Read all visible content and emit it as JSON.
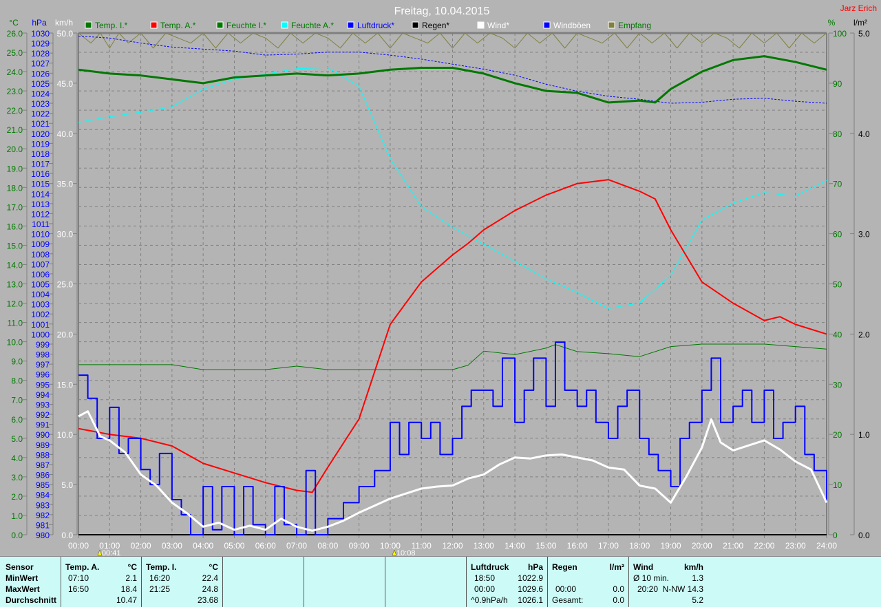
{
  "title": "Freitag, 10.04.2015",
  "author": "Jarz Erich",
  "legend": [
    {
      "label": "Temp. I.*",
      "color": "#007800",
      "text_color": "#007800"
    },
    {
      "label": "Temp. A.*",
      "color": "#ff0000",
      "text_color": "#007800"
    },
    {
      "label": "Feuchte I.*",
      "color": "#007800",
      "text_color": "#007800"
    },
    {
      "label": "Feuchte A.*",
      "color": "#00ffff",
      "text_color": "#007800"
    },
    {
      "label": "Luftdruck*",
      "color": "#0000ff",
      "text_color": "#0000ff"
    },
    {
      "label": "Regen*",
      "color": "#000000",
      "text_color": "#000000"
    },
    {
      "label": "Wind*",
      "color": "#ffffff",
      "text_color": "#ffffff"
    },
    {
      "label": "Windböen",
      "color": "#0000ff",
      "text_color": "#ffffff"
    },
    {
      "label": "Empfang",
      "color": "#808040",
      "text_color": "#007800"
    }
  ],
  "chart_data": {
    "type": "line",
    "title": "Freitag, 10.04.2015",
    "x_unit": "hour",
    "xlim": [
      0,
      24
    ],
    "x_ticks": [
      "00:00",
      "01:00",
      "02:00",
      "03:00",
      "04:00",
      "05:00",
      "06:00",
      "07:00",
      "08:00",
      "09:00",
      "10:00",
      "11:00",
      "12:00",
      "13:00",
      "14:00",
      "15:00",
      "16:00",
      "17:00",
      "18:00",
      "19:00",
      "20:00",
      "21:00",
      "22:00",
      "23:00",
      "24:00"
    ],
    "axes": {
      "temp": {
        "label": "°C",
        "range": [
          0,
          26
        ],
        "step": 1,
        "color": "#007800"
      },
      "pressure": {
        "label": "hPa",
        "range": [
          980,
          1030
        ],
        "step": 1,
        "color": "#0000ff"
      },
      "wind": {
        "label": "km/h",
        "range": [
          0,
          50
        ],
        "step": 5,
        "color": "#ffffff"
      },
      "humidity": {
        "label": "%",
        "range": [
          0,
          100
        ],
        "step": 10,
        "color": "#007800"
      },
      "rain": {
        "label": "l/m²",
        "range": [
          0,
          5
        ],
        "step": 1,
        "color": "#000000"
      }
    },
    "grid": true,
    "markers": [
      {
        "time": "00:41",
        "x": 0.683
      },
      {
        "time": "10:08",
        "x": 10.133
      }
    ],
    "series": [
      {
        "name": "Empfang",
        "axis": "humidity",
        "color": "#808040",
        "width": 1,
        "x": [
          0,
          0.4,
          0.7,
          1,
          1.3,
          1.6,
          2,
          2.4,
          2.8,
          3.2,
          3.6,
          4,
          4.4,
          4.8,
          5.2,
          5.6,
          6,
          6.4,
          6.8,
          7.2,
          7.6,
          8,
          8.4,
          8.8,
          9.2,
          9.6,
          10,
          10.4,
          10.8,
          11.2,
          11.6,
          12,
          12.4,
          12.8,
          13.2,
          13.6,
          14,
          14.4,
          14.8,
          15.2,
          15.6,
          16,
          16.4,
          16.8,
          17.2,
          17.6,
          18,
          18.4,
          18.8,
          19.2,
          19.6,
          20,
          20.4,
          20.8,
          21.2,
          21.6,
          22,
          22.4,
          22.8,
          23.2,
          23.6,
          24
        ],
        "y": [
          100,
          98,
          100,
          97,
          100,
          98,
          100,
          97,
          100,
          99,
          98,
          100,
          97,
          100,
          98,
          100,
          99,
          97,
          100,
          98,
          100,
          99,
          97,
          100,
          98,
          100,
          97,
          100,
          99,
          98,
          100,
          97,
          100,
          98,
          100,
          99,
          97,
          100,
          98,
          100,
          97,
          100,
          99,
          98,
          100,
          97,
          100,
          98,
          100,
          97,
          100,
          98,
          100,
          99,
          97,
          100,
          98,
          100,
          97,
          100,
          98,
          100
        ]
      },
      {
        "name": "Luftdruck",
        "axis": "pressure",
        "color": "#0000ff",
        "width": 1,
        "dash": true,
        "x": [
          0,
          1,
          2,
          3,
          4,
          5,
          6,
          7,
          8,
          9,
          10,
          11,
          12,
          13,
          14,
          15,
          16,
          17,
          18,
          19,
          20,
          21,
          22,
          23,
          24
        ],
        "y": [
          1029.7,
          1029.5,
          1029.0,
          1028.6,
          1028.4,
          1028.2,
          1027.8,
          1027.9,
          1028.1,
          1028.1,
          1027.8,
          1027.4,
          1026.9,
          1026.4,
          1025.8,
          1024.9,
          1024.2,
          1023.7,
          1023.4,
          1023.0,
          1023.1,
          1023.4,
          1023.5,
          1023.2,
          1023.0
        ]
      },
      {
        "name": "Feuchte I.",
        "axis": "humidity",
        "color": "#007800",
        "width": 1,
        "x": [
          0,
          1,
          2,
          3,
          4,
          5,
          6,
          7,
          8,
          9,
          10,
          11,
          12,
          12.5,
          13,
          14,
          15,
          15.3,
          16,
          17,
          18,
          19,
          20,
          21,
          22,
          23,
          24
        ],
        "y": [
          33.9,
          33.9,
          33.9,
          33.9,
          32.9,
          32.9,
          32.9,
          33.6,
          32.9,
          32.9,
          32.9,
          32.9,
          32.9,
          33.8,
          36.6,
          35.9,
          37.2,
          37.9,
          36.5,
          36.1,
          35.5,
          37.5,
          38.0,
          38.0,
          38.0,
          37.5,
          37.0
        ]
      },
      {
        "name": "Feuchte A.",
        "axis": "humidity",
        "color": "#00ffff",
        "width": 1,
        "x": [
          0,
          1,
          2,
          3,
          4,
          5,
          6,
          7,
          8,
          9,
          10,
          11,
          12,
          13,
          14,
          15,
          16,
          17,
          18,
          19,
          20,
          21,
          22,
          23,
          24
        ],
        "y": [
          82.2,
          83.3,
          84.2,
          85.3,
          88.8,
          90.8,
          91.8,
          92.9,
          93.1,
          89.4,
          75.0,
          65.4,
          61.3,
          57.9,
          54.5,
          51.0,
          48.3,
          45.1,
          46.2,
          51.7,
          62.7,
          66.1,
          68.2,
          67.5,
          70.6
        ]
      },
      {
        "name": "Temp. I.",
        "axis": "temp",
        "color": "#007800",
        "width": 3,
        "x": [
          0,
          1,
          2,
          3,
          4,
          5,
          6,
          7,
          8,
          9,
          10,
          11,
          12,
          13,
          14,
          15,
          16,
          17,
          18,
          18.5,
          19,
          20,
          21,
          22,
          23,
          24
        ],
        "y": [
          24.1,
          23.9,
          23.8,
          23.6,
          23.4,
          23.7,
          23.8,
          23.9,
          23.8,
          23.9,
          24.1,
          24.2,
          24.2,
          23.9,
          23.4,
          23.0,
          22.9,
          22.4,
          22.5,
          22.4,
          23.1,
          24.0,
          24.6,
          24.8,
          24.5,
          24.1
        ]
      },
      {
        "name": "Temp. A.",
        "axis": "temp",
        "color": "#ff0000",
        "width": 2,
        "x": [
          0,
          1,
          2,
          3,
          4,
          5,
          6,
          7,
          7.5,
          8,
          9,
          10,
          11,
          12,
          12.5,
          13,
          14,
          15,
          16,
          17,
          18,
          18.5,
          19,
          20,
          21,
          22,
          22.5,
          23,
          24
        ],
        "y": [
          5.5,
          5.2,
          5.0,
          4.6,
          3.7,
          3.2,
          2.7,
          2.3,
          2.2,
          3.5,
          6.0,
          10.9,
          13.1,
          14.5,
          15.1,
          15.8,
          16.8,
          17.6,
          18.2,
          18.4,
          17.8,
          17.4,
          15.8,
          13.1,
          12.0,
          11.1,
          11.3,
          10.9,
          10.4
        ]
      },
      {
        "name": "Windböen",
        "axis": "wind",
        "color": "#0000ff",
        "width": 2,
        "step": true,
        "x": [
          0,
          0.3,
          0.6,
          1,
          1.3,
          1.6,
          2,
          2.3,
          2.6,
          3,
          3.3,
          3.6,
          4,
          4.3,
          4.6,
          5,
          5.3,
          5.6,
          6,
          6.3,
          6.6,
          7,
          7.3,
          7.6,
          8,
          8.5,
          9,
          9.5,
          10,
          10.3,
          10.6,
          11,
          11.3,
          11.6,
          12,
          12.3,
          12.6,
          13,
          13.3,
          13.6,
          14,
          14.3,
          14.6,
          15,
          15.3,
          15.6,
          16,
          16.3,
          16.6,
          17,
          17.3,
          17.6,
          18,
          18.3,
          18.6,
          19,
          19.3,
          19.6,
          20,
          20.3,
          20.6,
          21,
          21.3,
          21.6,
          22,
          22.3,
          22.6,
          23,
          23.3,
          23.6,
          24
        ],
        "y": [
          15.9,
          13.6,
          9.6,
          12.7,
          8.1,
          9.6,
          6.5,
          5.0,
          8.1,
          3.5,
          2.0,
          0,
          4.8,
          0.5,
          4.8,
          0,
          4.8,
          1.0,
          0,
          4.8,
          1.0,
          0,
          6.4,
          0,
          1.6,
          3.2,
          4.8,
          6.4,
          11.2,
          8.0,
          11.2,
          9.6,
          11.2,
          8.0,
          9.6,
          12.8,
          14.4,
          14.4,
          12.8,
          17.6,
          11.2,
          14.4,
          17.6,
          12.8,
          19.2,
          14.4,
          12.8,
          14.4,
          11.2,
          9.6,
          12.8,
          14.4,
          9.6,
          8.0,
          6.4,
          4.8,
          9.6,
          11.2,
          14.4,
          17.6,
          11.2,
          12.8,
          14.4,
          11.2,
          14.4,
          9.6,
          11.2,
          12.8,
          8.0,
          6.4,
          3.2
        ]
      },
      {
        "name": "Wind",
        "axis": "wind",
        "color": "#ffffff",
        "width": 3,
        "x": [
          0,
          0.3,
          0.7,
          1,
          1.5,
          2,
          2.5,
          3,
          3.5,
          4,
          4.5,
          5,
          5.5,
          6,
          6.5,
          7,
          7.5,
          8,
          8.5,
          9,
          9.5,
          10,
          10.5,
          11,
          11.5,
          12,
          12.5,
          13,
          13.5,
          14,
          14.5,
          15,
          15.5,
          16,
          16.5,
          17,
          17.5,
          18,
          18.5,
          19,
          19.5,
          20,
          20.3,
          20.6,
          21,
          21.5,
          22,
          22.5,
          23,
          23.5,
          24
        ],
        "y": [
          11.8,
          12.3,
          9.8,
          9.4,
          8.2,
          6.0,
          4.9,
          3.2,
          2.1,
          0.8,
          1.2,
          0.5,
          0.9,
          0.5,
          1.6,
          0.8,
          0.4,
          0.8,
          1.4,
          2.2,
          2.9,
          3.6,
          4.1,
          4.6,
          4.8,
          4.9,
          5.6,
          6.0,
          7.0,
          7.7,
          7.6,
          7.9,
          8.0,
          7.7,
          7.4,
          6.7,
          6.5,
          4.9,
          4.6,
          3.2,
          5.8,
          8.7,
          11.5,
          9.2,
          8.4,
          8.9,
          9.4,
          8.5,
          7.3,
          6.5,
          3.2
        ]
      }
    ]
  },
  "stats": {
    "sensor": {
      "header": "Sensor",
      "rows": [
        "MinWert",
        "MaxWert",
        "Durchschnitt"
      ]
    },
    "temp_a": {
      "header": "Temp. A.",
      "unit": "°C",
      "min_time": "07:10",
      "min": "2.1",
      "max_time": "16:50",
      "max": "18.4",
      "avg": "10.47"
    },
    "temp_i": {
      "header": "Temp. I.",
      "unit": "°C",
      "min_time": "16:20",
      "min": "22.4",
      "max_time": "21:25",
      "max": "24.8",
      "avg": "23.68"
    },
    "pressure": {
      "header": "Luftdruck",
      "unit": "hPa",
      "min_time": "18:50",
      "min": "1022.9",
      "max_time": "00:00",
      "max": "1029.6",
      "trend": "^0.9hPa/h",
      "avg": "1026.1"
    },
    "rain": {
      "header": "Regen",
      "unit": "l/m²",
      "max_time": "00:00",
      "max": "0.0",
      "total_label": "Gesamt:",
      "total": "0.0"
    },
    "wind": {
      "header": "Wind",
      "unit": "km/h",
      "avg10_label": "Ø 10 min.",
      "avg10": "1.3",
      "max_time": "20:20",
      "max": "N-NW 14.3",
      "avg": "5.2"
    }
  }
}
